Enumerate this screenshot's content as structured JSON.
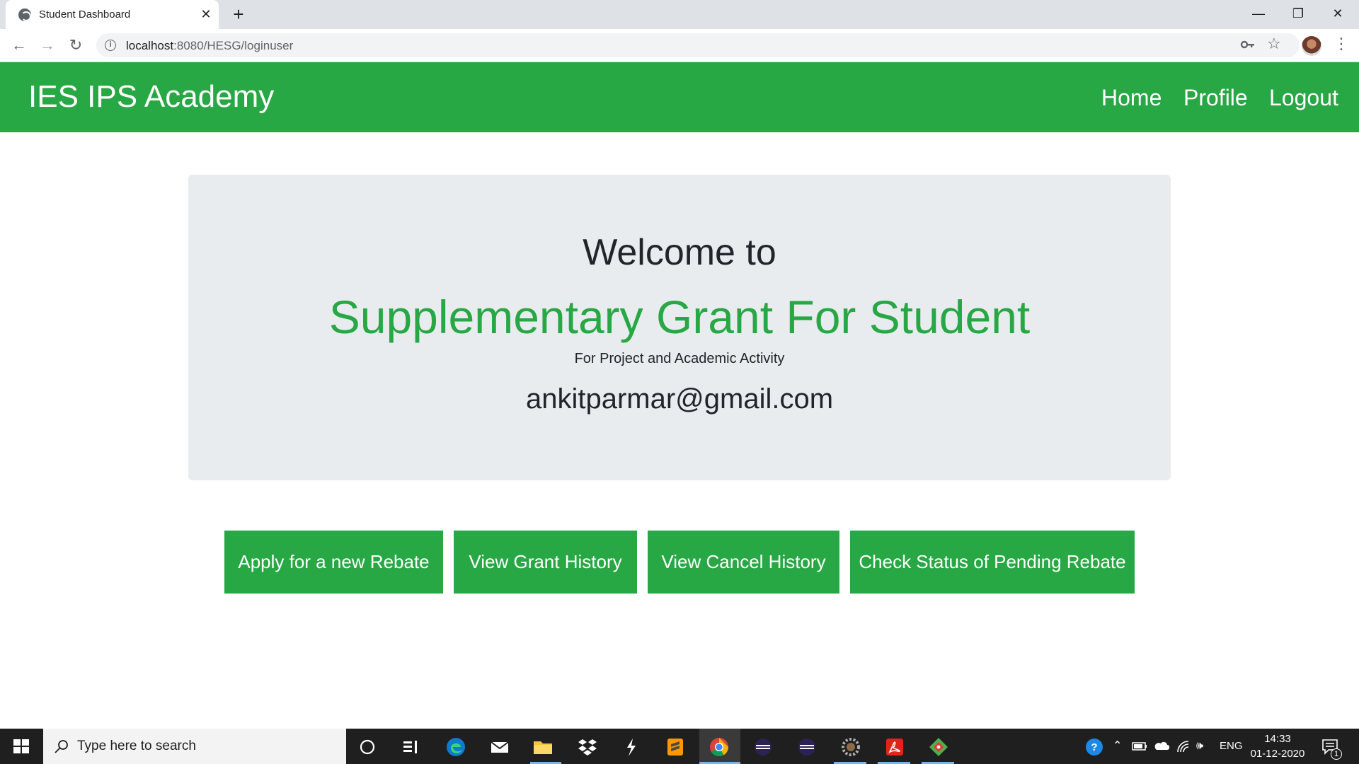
{
  "browser": {
    "tab_title": "Student Dashboard",
    "url_host": "localhost",
    "url_rest": ":8080/HESG/loginuser"
  },
  "navbar": {
    "brand": "IES IPS Academy",
    "links": [
      "Home",
      "Profile",
      "Logout"
    ]
  },
  "jumbotron": {
    "welcome": "Welcome to",
    "title": "Supplementary Grant For Student",
    "subtitle": "For Project and Academic Activity",
    "email": "ankitparmar@gmail.com"
  },
  "actions": [
    "Apply for a new Rebate",
    "View Grant History",
    "View Cancel History",
    "Check Status of Pending Rebate"
  ],
  "taskbar": {
    "search_placeholder": "Type here to search",
    "language": "ENG",
    "time": "14:33",
    "date": "01-12-2020",
    "notification_count": "1"
  },
  "colors": {
    "brand_green": "#28a745",
    "jumbotron_bg": "#e9ecef"
  }
}
